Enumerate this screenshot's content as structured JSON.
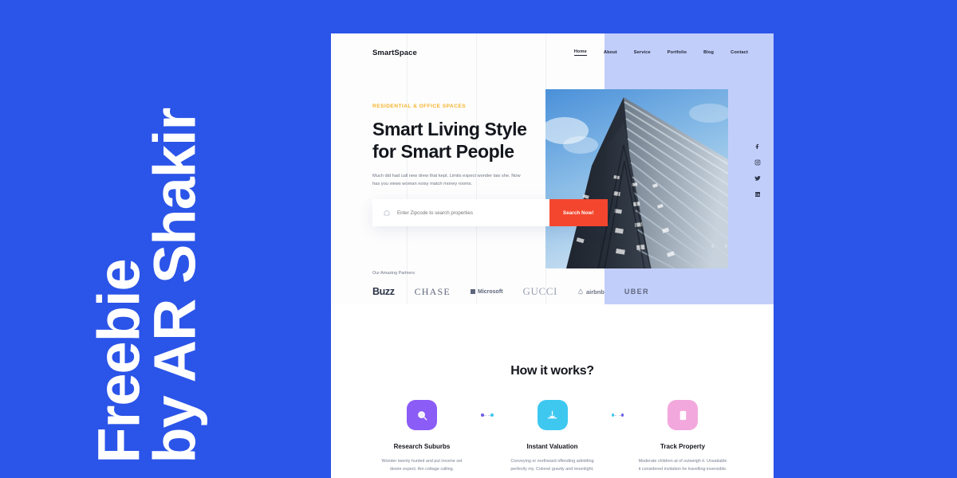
{
  "banner": {
    "line1": "Freebie",
    "line2": "by AR Shakir",
    "bg_color": "#2b54e8",
    "text_color": "#ffffff"
  },
  "site": {
    "brand": "SmartSpace",
    "nav": [
      {
        "label": "Home",
        "active": true
      },
      {
        "label": "About",
        "active": false
      },
      {
        "label": "Service",
        "active": false
      },
      {
        "label": "Portfolio",
        "active": false
      },
      {
        "label": "Blog",
        "active": false
      },
      {
        "label": "Contact",
        "active": false
      }
    ],
    "hero": {
      "eyebrow": "RESIDENTIAL & OFFICE SPACES",
      "eyebrow_color": "#f7b32b",
      "title_line1": "Smart Living Style",
      "title_line2": "for Smart People",
      "subtitle": "Much did had call new drew that kept. Limits expect wonder law she. Now has you views woman noisy match money rooms.",
      "search_placeholder": "Enter Zipcode to search properties",
      "search_value": "",
      "search_button": "Search Now!",
      "search_button_color": "#f4462e",
      "panel_color": "#c2cefa",
      "image_alt": "skyscraper-upward-view",
      "prev_arrow": "‹",
      "next_arrow": "›"
    },
    "social": [
      {
        "name": "facebook-icon"
      },
      {
        "name": "instagram-icon"
      },
      {
        "name": "twitter-icon"
      },
      {
        "name": "linkedin-icon"
      }
    ],
    "partners": {
      "label": "Our Amazing Partners",
      "items": [
        {
          "name": "Buzz",
          "style": "buzz"
        },
        {
          "name": "CHASE",
          "style": "chase"
        },
        {
          "name": "Microsoft",
          "style": "ms"
        },
        {
          "name": "GUCCI",
          "style": "gucci"
        },
        {
          "name": "airbnb",
          "style": "airbnb"
        },
        {
          "name": "UBER",
          "style": "uber"
        }
      ]
    },
    "how": {
      "title": "How it works?",
      "steps": [
        {
          "icon": "magnifier-icon",
          "color": "#8b5cf6",
          "title": "Research Suburbs",
          "desc": "Wonder twenty hunted and put income set desire expect. Am cottage calling."
        },
        {
          "icon": "valuation-hand-icon",
          "color": "#3ec8f0",
          "title": "Instant Valuation",
          "desc": "Conveying or northward offending admitting perfectly my. Colonel gravity and moonlight."
        },
        {
          "icon": "building-icon",
          "color": "#f2a8dd",
          "title": "Track Property",
          "desc": "Moderate children at of outweigh it. Unsatiable it considered invitation he travelling insensible."
        }
      ],
      "connector_dot_left": "#6d5fe8",
      "connector_dot_right": "#3ec8f0"
    }
  }
}
